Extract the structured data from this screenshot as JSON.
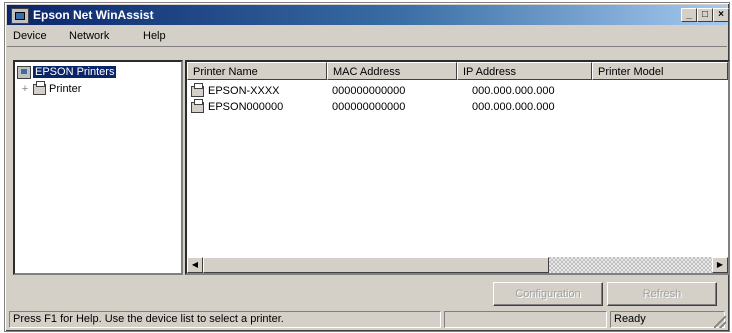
{
  "window": {
    "title": "Epson Net WinAssist"
  },
  "title_buttons": {
    "minimize": "_",
    "maximize": "□",
    "close": "×"
  },
  "menu": {
    "items": [
      "Device",
      "Network",
      "Help"
    ]
  },
  "tree": {
    "root": "EPSON Printers",
    "expander": "+",
    "child": "Printer"
  },
  "list": {
    "columns": [
      "Printer Name",
      "MAC Address",
      "IP Address",
      "Printer Model"
    ],
    "rows": [
      {
        "name": "EPSON-XXXX",
        "mac": "000000000000",
        "ip": "000.000.000.000",
        "model": ""
      },
      {
        "name": "EPSON000000",
        "mac": "000000000000",
        "ip": "000.000.000.000",
        "model": ""
      }
    ]
  },
  "scrollbar": {
    "left_arrow": "◀",
    "right_arrow": "▶"
  },
  "buttons": {
    "configuration": "Configuration",
    "refresh": "Refresh"
  },
  "status": {
    "message": "Press F1 for Help. Use the device list to select a printer.",
    "pane2": "",
    "pane3": "Ready"
  }
}
